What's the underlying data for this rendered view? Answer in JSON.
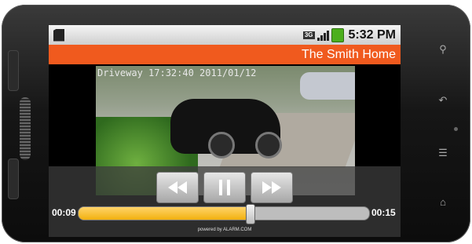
{
  "status": {
    "network": "3G",
    "time": "5:32 PM"
  },
  "app": {
    "title": "The Smith Home"
  },
  "video": {
    "overlay": "Driveway 17:32:40 2011/01/12"
  },
  "player": {
    "elapsed": "00:09",
    "duration": "00:15",
    "progress": 0.59,
    "powered_by": "powered by ALARM.COM"
  },
  "icons": {
    "rewind": "rewind-icon",
    "pause": "pause-icon",
    "forward": "fast-forward-icon",
    "search": "search-icon",
    "back": "back-icon",
    "menu": "menu-icon",
    "home": "home-icon"
  },
  "colors": {
    "accent": "#f05a1e",
    "progress": "#f2b10f"
  }
}
